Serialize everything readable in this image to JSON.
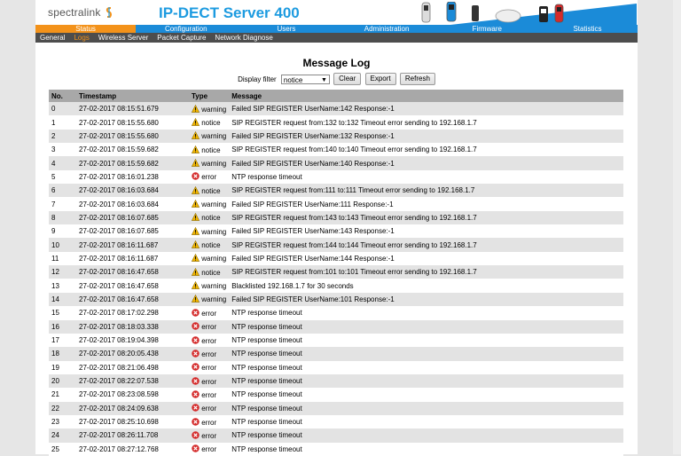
{
  "header": {
    "brand": "spectralink",
    "product": "IP-DECT Server 400"
  },
  "topnav": [
    {
      "label": "Status",
      "active": true
    },
    {
      "label": "Configuration",
      "active": false
    },
    {
      "label": "Users",
      "active": false
    },
    {
      "label": "Administration",
      "active": false
    },
    {
      "label": "Firmware",
      "active": false
    },
    {
      "label": "Statistics",
      "active": false
    }
  ],
  "subnav": [
    {
      "label": "General",
      "active": false
    },
    {
      "label": "Logs",
      "active": true
    },
    {
      "label": "Wireless Server",
      "active": false
    },
    {
      "label": "Packet Capture",
      "active": false
    },
    {
      "label": "Network Diagnose",
      "active": false
    }
  ],
  "page": {
    "title": "Message Log"
  },
  "filter": {
    "label": "Display filter",
    "value": "notice",
    "buttons": [
      "Clear",
      "Export",
      "Refresh"
    ]
  },
  "table": {
    "headers": [
      "No.",
      "Timestamp",
      "Type",
      "Message"
    ],
    "rows": [
      {
        "no": "0",
        "ts": "27-02-2017 08:15:51.679",
        "type": "warning",
        "msg": "Failed SIP REGISTER UserName:142 Response:-1"
      },
      {
        "no": "1",
        "ts": "27-02-2017 08:15:55.680",
        "type": "notice",
        "msg": "SIP REGISTER request from:132 to:132 Timeout error sending to 192.168.1.7"
      },
      {
        "no": "2",
        "ts": "27-02-2017 08:15:55.680",
        "type": "warning",
        "msg": "Failed SIP REGISTER UserName:132 Response:-1"
      },
      {
        "no": "3",
        "ts": "27-02-2017 08:15:59.682",
        "type": "notice",
        "msg": "SIP REGISTER request from:140 to:140 Timeout error sending to 192.168.1.7"
      },
      {
        "no": "4",
        "ts": "27-02-2017 08:15:59.682",
        "type": "warning",
        "msg": "Failed SIP REGISTER UserName:140 Response:-1"
      },
      {
        "no": "5",
        "ts": "27-02-2017 08:16:01.238",
        "type": "error",
        "msg": "NTP response timeout"
      },
      {
        "no": "6",
        "ts": "27-02-2017 08:16:03.684",
        "type": "notice",
        "msg": "SIP REGISTER request from:111 to:111 Timeout error sending to 192.168.1.7"
      },
      {
        "no": "7",
        "ts": "27-02-2017 08:16:03.684",
        "type": "warning",
        "msg": "Failed SIP REGISTER UserName:111 Response:-1"
      },
      {
        "no": "8",
        "ts": "27-02-2017 08:16:07.685",
        "type": "notice",
        "msg": "SIP REGISTER request from:143 to:143 Timeout error sending to 192.168.1.7"
      },
      {
        "no": "9",
        "ts": "27-02-2017 08:16:07.685",
        "type": "warning",
        "msg": "Failed SIP REGISTER UserName:143 Response:-1"
      },
      {
        "no": "10",
        "ts": "27-02-2017 08:16:11.687",
        "type": "notice",
        "msg": "SIP REGISTER request from:144 to:144 Timeout error sending to 192.168.1.7"
      },
      {
        "no": "11",
        "ts": "27-02-2017 08:16:11.687",
        "type": "warning",
        "msg": "Failed SIP REGISTER UserName:144 Response:-1"
      },
      {
        "no": "12",
        "ts": "27-02-2017 08:16:47.658",
        "type": "notice",
        "msg": "SIP REGISTER request from:101 to:101 Timeout error sending to 192.168.1.7"
      },
      {
        "no": "13",
        "ts": "27-02-2017 08:16:47.658",
        "type": "warning",
        "msg": "Blacklisted 192.168.1.7 for 30 seconds"
      },
      {
        "no": "14",
        "ts": "27-02-2017 08:16:47.658",
        "type": "warning",
        "msg": "Failed SIP REGISTER UserName:101 Response:-1"
      },
      {
        "no": "15",
        "ts": "27-02-2017 08:17:02.298",
        "type": "error",
        "msg": "NTP response timeout"
      },
      {
        "no": "16",
        "ts": "27-02-2017 08:18:03.338",
        "type": "error",
        "msg": "NTP response timeout"
      },
      {
        "no": "17",
        "ts": "27-02-2017 08:19:04.398",
        "type": "error",
        "msg": "NTP response timeout"
      },
      {
        "no": "18",
        "ts": "27-02-2017 08:20:05.438",
        "type": "error",
        "msg": "NTP response timeout"
      },
      {
        "no": "19",
        "ts": "27-02-2017 08:21:06.498",
        "type": "error",
        "msg": "NTP response timeout"
      },
      {
        "no": "20",
        "ts": "27-02-2017 08:22:07.538",
        "type": "error",
        "msg": "NTP response timeout"
      },
      {
        "no": "21",
        "ts": "27-02-2017 08:23:08.598",
        "type": "error",
        "msg": "NTP response timeout"
      },
      {
        "no": "22",
        "ts": "27-02-2017 08:24:09.638",
        "type": "error",
        "msg": "NTP response timeout"
      },
      {
        "no": "23",
        "ts": "27-02-2017 08:25:10.698",
        "type": "error",
        "msg": "NTP response timeout"
      },
      {
        "no": "24",
        "ts": "27-02-2017 08:26:11.708",
        "type": "error",
        "msg": "NTP response timeout"
      },
      {
        "no": "25",
        "ts": "27-02-2017 08:27:12.768",
        "type": "error",
        "msg": "NTP response timeout"
      }
    ]
  },
  "icons": {
    "warning": "warning-icon",
    "notice": "warning-icon",
    "error": "error-icon"
  },
  "colors": {
    "accent_blue": "#1b8bd8",
    "active_orange": "#f3921a",
    "subnav_bg": "#4d4d4d",
    "header_row": "#a8a8a8",
    "row_alt": "#e3e3e3"
  }
}
